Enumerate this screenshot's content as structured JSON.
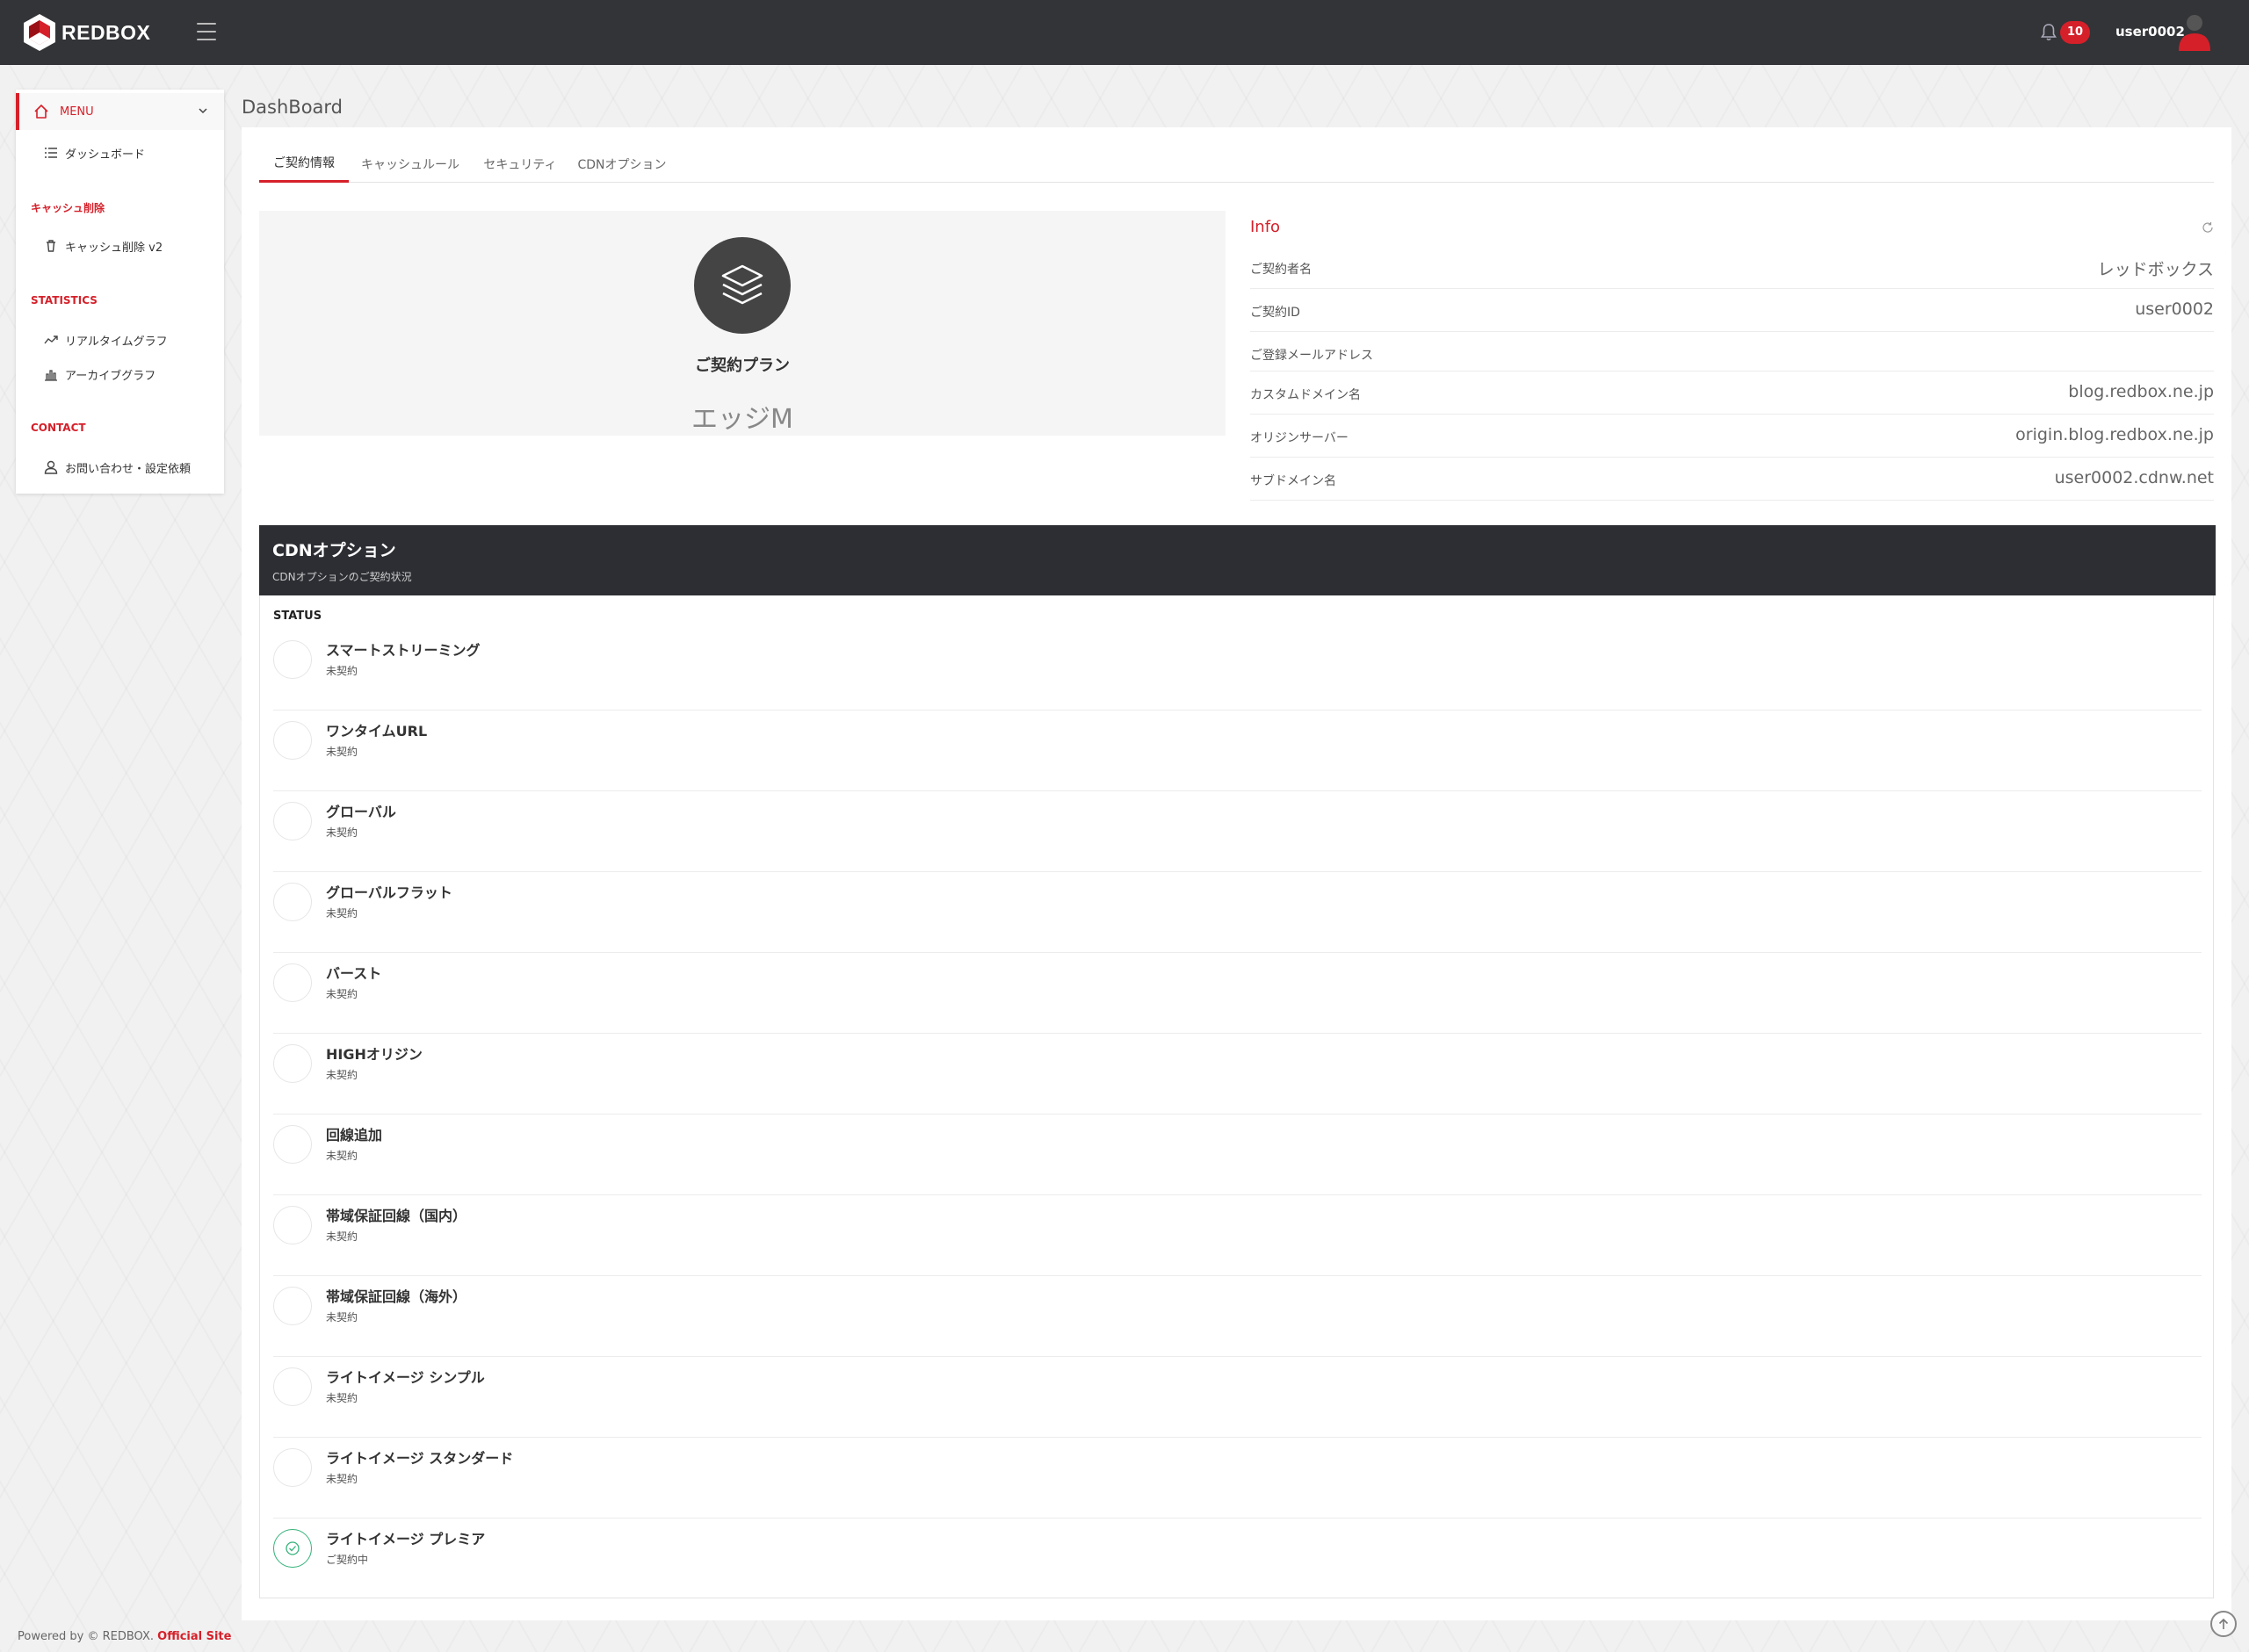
{
  "brand": {
    "name": "REDBOX",
    "accent": "#d5202a",
    "dark": "#333437"
  },
  "header": {
    "notification_count": "10",
    "username": "user0002"
  },
  "sidebar": {
    "menu_label": "MENU",
    "dashboard": "ダッシュボード",
    "cache_section": "キャッシュ削除",
    "cache_delete": "キャッシュ削除 v2",
    "stats_section": "STATISTICS",
    "realtime_graph": "リアルタイムグラフ",
    "archive_graph": "アーカイブグラフ",
    "contact_section": "CONTACT",
    "contact_item": "お問い合わせ・設定依頼"
  },
  "page": {
    "title": "DashBoard"
  },
  "tabs": [
    {
      "label": "ご契約情報",
      "active": true
    },
    {
      "label": "キャッシュルール",
      "active": false
    },
    {
      "label": "セキュリティ",
      "active": false
    },
    {
      "label": "CDNオプション",
      "active": false
    }
  ],
  "plan": {
    "label": "ご契約プラン",
    "name": "エッジM",
    "icon": "layers-icon"
  },
  "info": {
    "title": "Info",
    "rows": [
      {
        "key": "ご契約者名",
        "value": "レッドボックス"
      },
      {
        "key": "ご契約ID",
        "value": "user0002"
      },
      {
        "key": "ご登録メールアドレス",
        "value": ""
      },
      {
        "key": "カスタムドメイン名",
        "value": "blog.redbox.ne.jp"
      },
      {
        "key": "オリジンサーバー",
        "value": "origin.blog.redbox.ne.jp"
      },
      {
        "key": "サブドメイン名",
        "value": "user0002.cdnw.net"
      }
    ]
  },
  "cdn": {
    "title": "CDNオプション",
    "subtitle": "CDNオプションのご契約状況",
    "status_header": "STATUS",
    "options": [
      {
        "name": "スマートストリーミング",
        "status": "未契約",
        "active": false
      },
      {
        "name": "ワンタイムURL",
        "status": "未契約",
        "active": false
      },
      {
        "name": "グローバル",
        "status": "未契約",
        "active": false
      },
      {
        "name": "グローバルフラット",
        "status": "未契約",
        "active": false
      },
      {
        "name": "バースト",
        "status": "未契約",
        "active": false
      },
      {
        "name": "HIGHオリジン",
        "status": "未契約",
        "active": false
      },
      {
        "name": "回線追加",
        "status": "未契約",
        "active": false
      },
      {
        "name": "帯域保証回線（国内）",
        "status": "未契約",
        "active": false
      },
      {
        "name": "帯域保証回線（海外）",
        "status": "未契約",
        "active": false
      },
      {
        "name": "ライトイメージ シンプル",
        "status": "未契約",
        "active": false
      },
      {
        "name": "ライトイメージ スタンダード",
        "status": "未契約",
        "active": false
      },
      {
        "name": "ライトイメージ プレミア",
        "status": "ご契約中",
        "active": true
      }
    ]
  },
  "footer": {
    "text": "Powered by © REDBOX.",
    "link": "Official Site"
  }
}
